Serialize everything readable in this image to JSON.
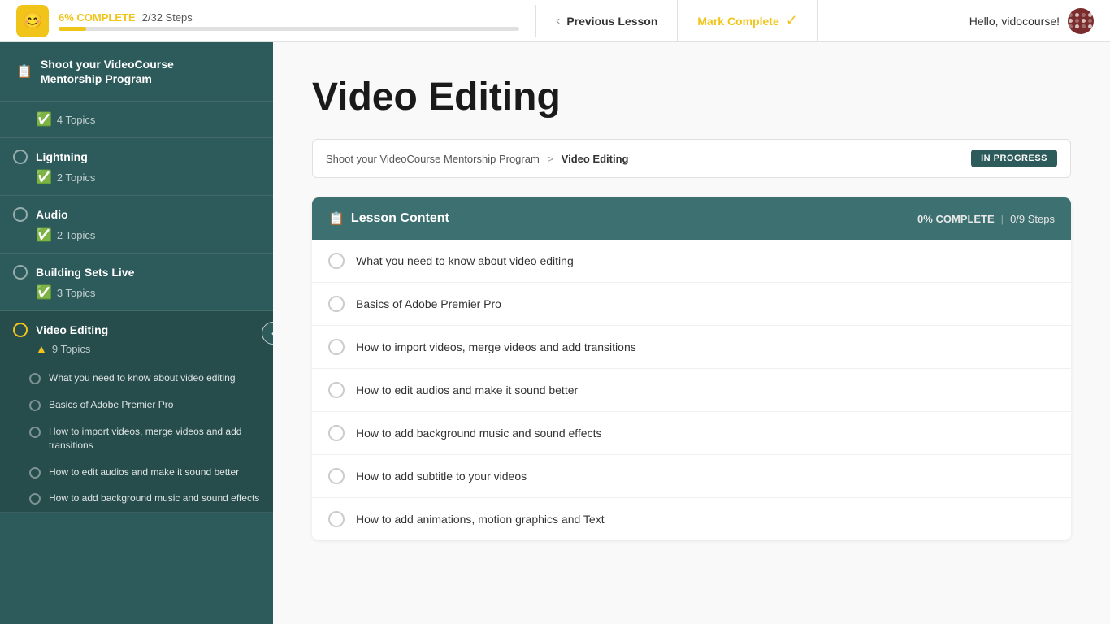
{
  "topBar": {
    "progress": {
      "pctLabel": "6% COMPLETE",
      "stepsLabel": "2/32 Steps",
      "fillWidth": "6%"
    },
    "nav": {
      "prevLabel": "Previous Lesson"
    },
    "markComplete": {
      "label": "Mark Complete"
    },
    "user": {
      "greeting": "Hello, vidocourse!"
    }
  },
  "sidebar": {
    "title": "Shoot your VideoCourse\nMentorship Program",
    "sections": [
      {
        "id": "intro",
        "title": "",
        "topicsLabel": "4 Topics",
        "radio": "checked",
        "expanded": false,
        "lessons": []
      },
      {
        "id": "lightning",
        "title": "Lightning",
        "topicsLabel": "2 Topics",
        "radio": "normal",
        "expanded": false,
        "lessons": []
      },
      {
        "id": "audio",
        "title": "Audio",
        "topicsLabel": "2 Topics",
        "radio": "normal",
        "expanded": false,
        "lessons": []
      },
      {
        "id": "building-sets",
        "title": "Building Sets Live",
        "topicsLabel": "3 Topics",
        "radio": "normal",
        "expanded": false,
        "lessons": []
      },
      {
        "id": "video-editing",
        "title": "Video Editing",
        "topicsLabel": "9 Topics",
        "radio": "active",
        "expanded": true,
        "lessons": [
          "What you need to know about video editing",
          "Basics of Adobe Premier Pro",
          "How to import videos, merge videos and add transitions",
          "How to edit audios and make it sound better",
          "How to add background music and sound effects"
        ]
      }
    ]
  },
  "mainContent": {
    "pageTitle": "Video Editing",
    "breadcrumb": {
      "program": "Shoot your VideoCourse Mentorship Program",
      "separator": ">",
      "current": "Video Editing"
    },
    "badge": "IN PROGRESS",
    "lessonContent": {
      "title": "Lesson Content",
      "progressPct": "0% COMPLETE",
      "separator": "|",
      "steps": "0/9 Steps",
      "items": [
        "What you need to know about video editing",
        "Basics of Adobe Premier Pro",
        "How to import videos, merge videos and add transitions",
        "How to edit audios and make it sound better",
        "How to add background music and sound effects",
        "How to add subtitle to your videos",
        "How to add animations, motion graphics and Text"
      ]
    }
  }
}
